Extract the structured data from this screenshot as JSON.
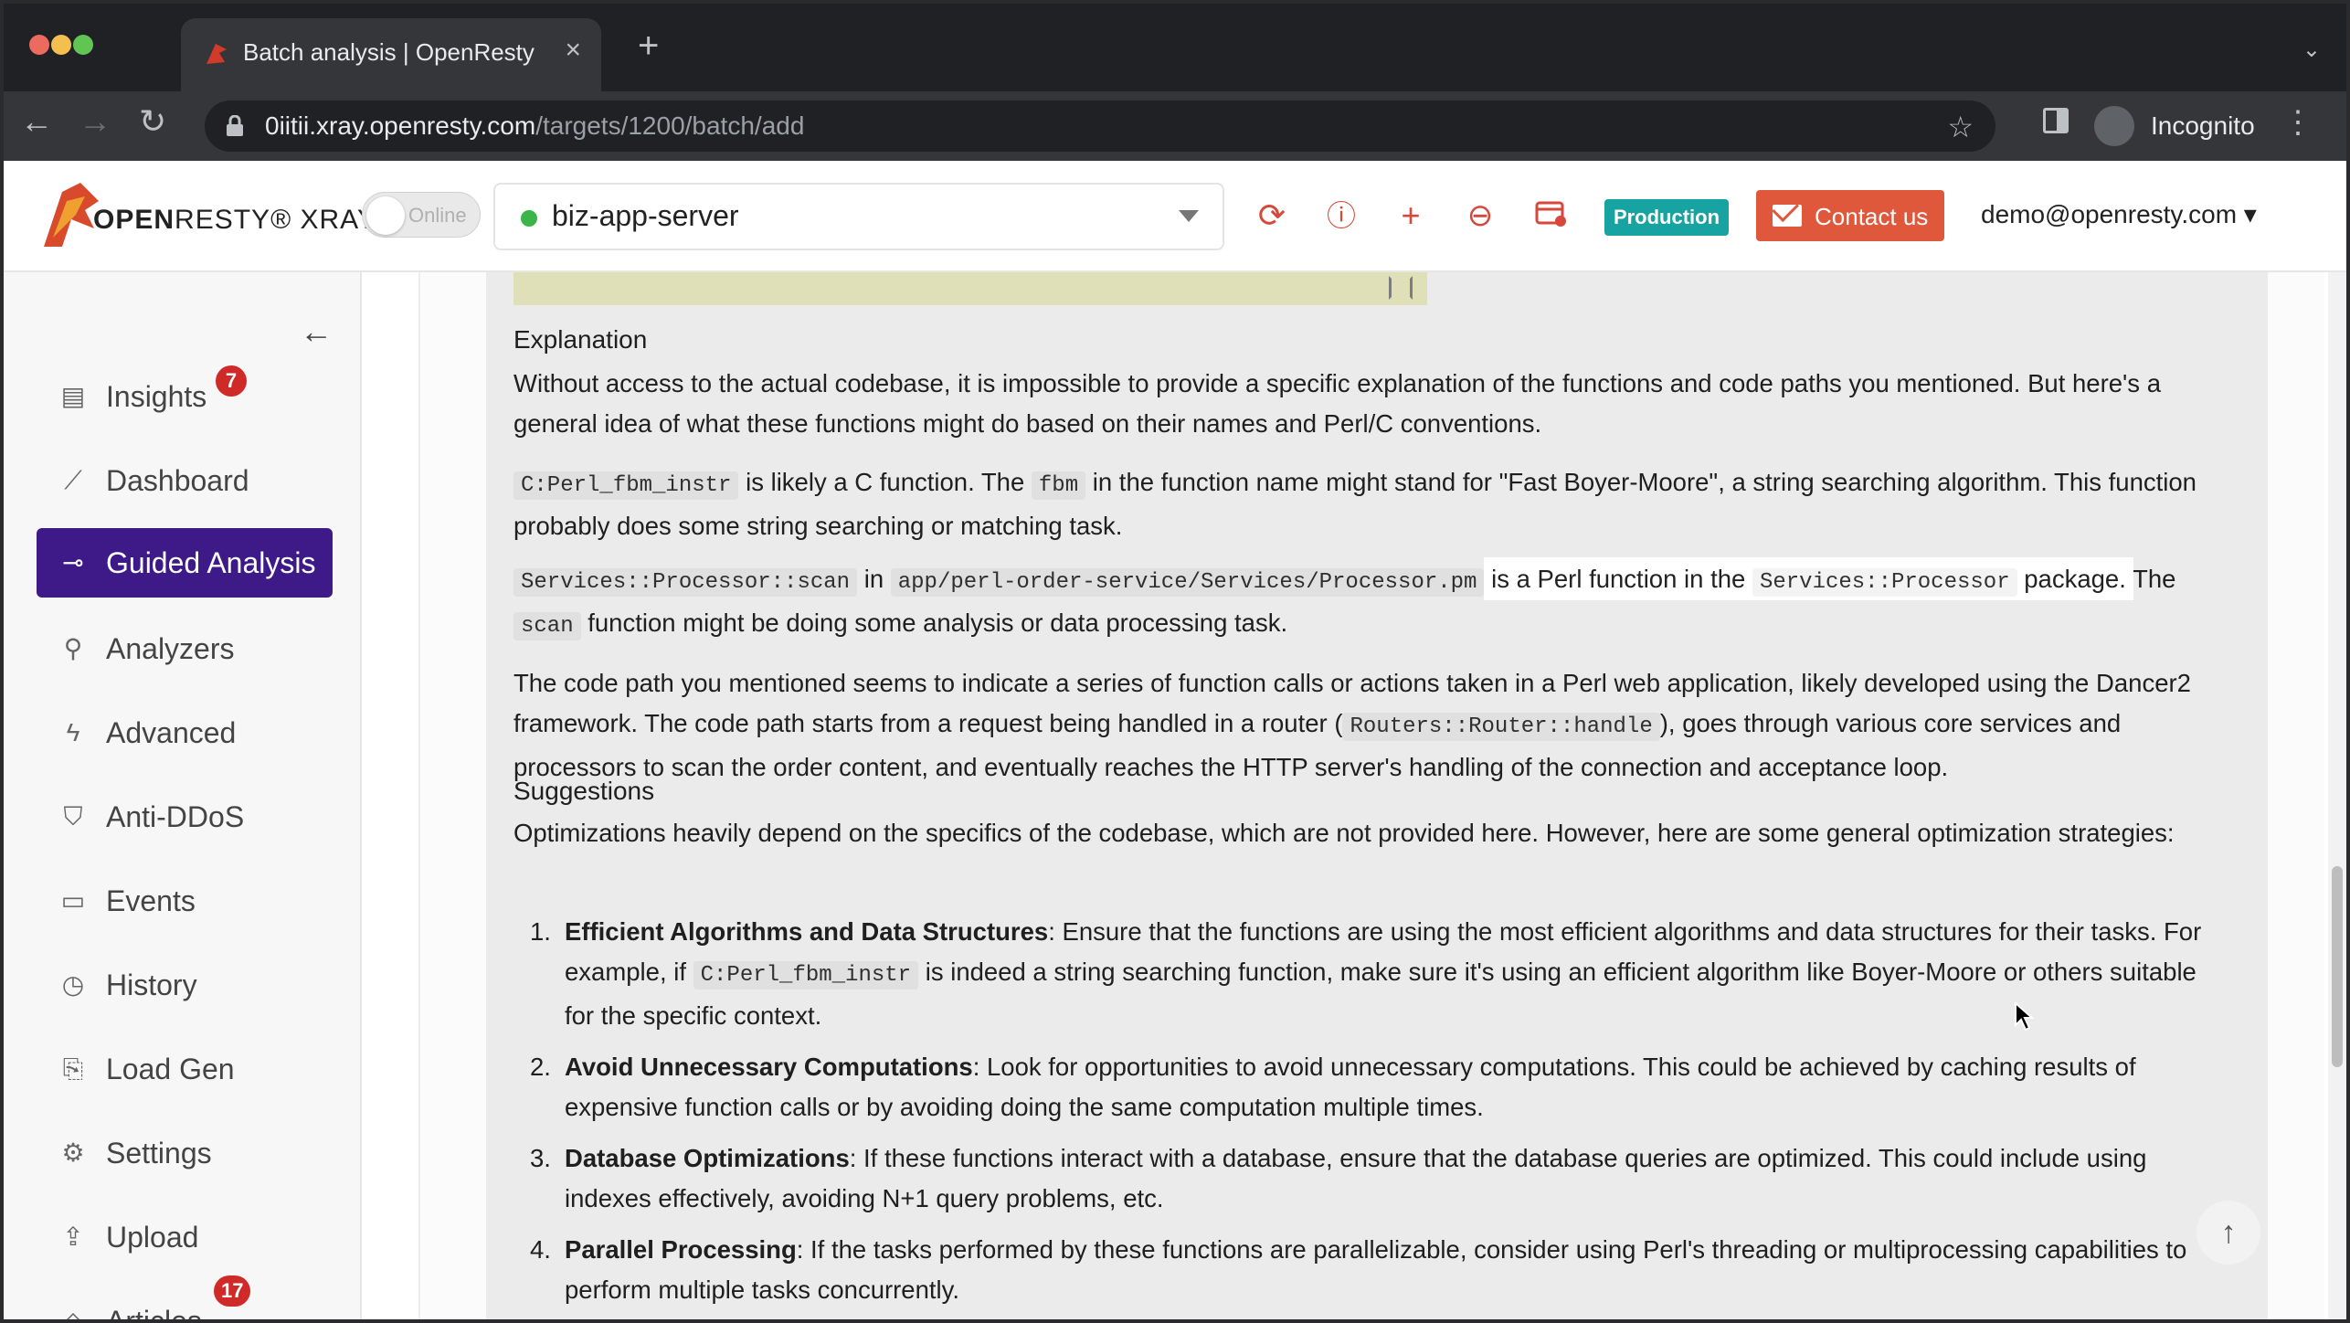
{
  "browser": {
    "tab_title": "Batch analysis | OpenResty XRay",
    "new_tab": "+",
    "url_host": "0iitii.xray.openresty.com",
    "url_path": "/targets/1200/batch/add",
    "profile_label": "Incognito"
  },
  "header": {
    "logo_text_open": "OPEN",
    "logo_text_resty": "RESTY",
    "logo_text_xray": "® XRAY",
    "online_label": "Online",
    "target_name": "biz-app-server",
    "env_badge": "Production",
    "contact_label": "Contact us",
    "user_email": "demo@openresty.com"
  },
  "sidebar": {
    "items": [
      {
        "label": "Insights",
        "icon": "document-icon",
        "badge": "7"
      },
      {
        "label": "Dashboard",
        "icon": "chart-icon"
      },
      {
        "label": "Guided Analysis",
        "icon": "guided-icon",
        "active": true
      },
      {
        "label": "Analyzers",
        "icon": "search-icon"
      },
      {
        "label": "Advanced",
        "icon": "lightning-icon"
      },
      {
        "label": "Anti-DDoS",
        "icon": "shield-icon"
      },
      {
        "label": "Events",
        "icon": "calendar-icon"
      },
      {
        "label": "History",
        "icon": "clock-icon"
      },
      {
        "label": "Load Gen",
        "icon": "load-icon"
      },
      {
        "label": "Settings",
        "icon": "gear-icon"
      },
      {
        "label": "Upload",
        "icon": "upload-icon"
      },
      {
        "label": "Articles",
        "icon": "book-icon",
        "badge": "17"
      }
    ]
  },
  "content": {
    "explanation_heading": "Explanation",
    "explanation_p1": "Without access to the actual codebase, it is impossible to provide a specific explanation of the functions and code paths you mentioned. But here's a general idea of what these functions might do based on their names and Perl/C conventions.",
    "p2_code1": "C:Perl_fbm_instr",
    "p2_t1": " is likely a C function. The ",
    "p2_code2": "fbm",
    "p2_t2": " in the function name might stand for \"Fast Boyer-Moore\", a string searching algorithm. This function probably does some string searching or matching task.",
    "p3_code1": "Services::Processor::scan",
    "p3_t1": " in ",
    "p3_code2": "app/perl-order-service/Services/Processor.pm",
    "p3_hl1": "is a Perl function in the ",
    "p3_hl_code": "Services::Processor",
    "p3_hl2": " package.",
    "p3_t2": " The ",
    "p3_code3": "scan",
    "p3_t3": " function might be doing some analysis or data processing task.",
    "p4_t1": "The code path you mentioned seems to indicate a series of function calls or actions taken in a Perl web application, likely developed using the Dancer2 framework. The code path starts from a request being handled in a router (",
    "p4_code": "Routers::Router::handle",
    "p4_t2": "), goes through various core services and processors to scan the order content, and eventually reaches the HTTP server's handling of the connection and acceptance loop.",
    "suggestions_heading": "Suggestions",
    "suggestions_intro": "Optimizations heavily depend on the specifics of the codebase, which are not provided here. However, here are some general optimization strategies:",
    "s1_num": "1.",
    "s1_title": "Efficient Algorithms and Data Structures",
    "s1_t1": ": Ensure that the functions are using the most efficient algorithms and data structures for their tasks. For example, if ",
    "s1_code": "C:Perl_fbm_instr",
    "s1_t2": " is indeed a string searching function, make sure it's using an efficient algorithm like Boyer-Moore or others suitable for the specific context.",
    "s2_num": "2.",
    "s2_title": "Avoid Unnecessary Computations",
    "s2_t1": ": Look for opportunities to avoid unnecessary computations. This could be achieved by caching results of expensive function calls or by avoiding doing the same computation multiple times.",
    "s3_num": "3.",
    "s3_title": "Database Optimizations",
    "s3_t1": ": If these functions interact with a database, ensure that the database queries are optimized. This could include using indexes effectively, avoiding N+1 query problems, etc.",
    "s4_num": "4.",
    "s4_title": "Parallel Processing",
    "s4_t1": ": If the tasks performed by these functions are parallelizable, consider using Perl's threading or multiprocessing capabilities to perform multiple tasks concurrently."
  },
  "colors": {
    "accent": "#3d1a88",
    "production": "#18a3a3",
    "contact": "#e0583c",
    "badge": "#d02a28",
    "online_dot": "#3bb54a"
  }
}
